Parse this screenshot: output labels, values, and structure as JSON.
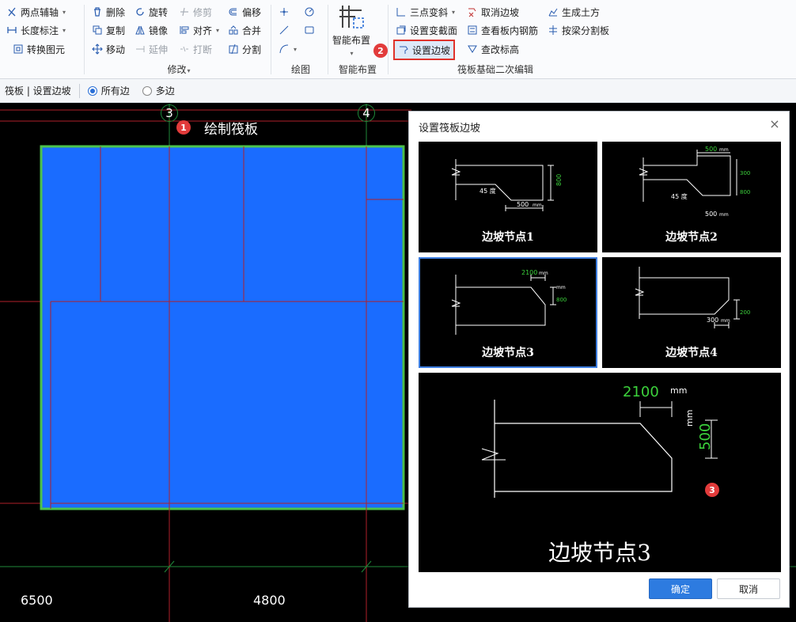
{
  "ribbon": {
    "axis": {
      "two_point_axis": "两点辅轴",
      "length_dim": "长度标注",
      "convert_element": "转换图元"
    },
    "modify": {
      "group": "修改",
      "delete": "删除",
      "rotate": "旋转",
      "trim": "修剪",
      "offset": "偏移",
      "copy": "复制",
      "mirror": "镜像",
      "align": "对齐",
      "merge": "合并",
      "move": "移动",
      "extend": "延伸",
      "break": "打断",
      "split": "分割"
    },
    "draw": {
      "group": "绘图"
    },
    "smart": {
      "button": "智能布置",
      "group": "智能布置"
    },
    "raft_edit": {
      "group": "筏板基础二次编辑",
      "three_point_slope": "三点变斜",
      "set_section": "设置变截面",
      "set_slope_edge": "设置边坡",
      "cancel_slope": "取消边坡",
      "view_rebar": "查看板内钢筋",
      "change_elevation": "查改标高",
      "gen_earthwork": "生成土方",
      "split_by_beam": "按梁分割板"
    }
  },
  "subbar": {
    "breadcrumb": "筏板 | 设置边坡",
    "option_all": "所有边",
    "option_multi": "多边"
  },
  "canvas": {
    "axis_3": "3",
    "axis_4": "4",
    "draw_raft_label": "绘制筏板",
    "dim_left": "6500",
    "dim_mid": "4800",
    "step1": "1",
    "step2": "2",
    "step3": "3"
  },
  "dialog": {
    "title": "设置筏板边坡",
    "close": "×",
    "nodes": [
      {
        "label": "边坡节点1",
        "dims": [
          "800",
          "45 度",
          "500",
          "mm"
        ]
      },
      {
        "label": "边坡节点2",
        "dims": [
          "500",
          "mm",
          "300",
          "800",
          "45 度",
          "500",
          "mm"
        ]
      },
      {
        "label": "边坡节点3",
        "dims": [
          "2100",
          "mm",
          "800",
          "mm"
        ]
      },
      {
        "label": "边坡节点4",
        "dims": [
          "200",
          "300",
          "mm"
        ]
      }
    ],
    "preview": {
      "label": "边坡节点3",
      "width_val": "2100",
      "width_unit": "mm",
      "height_val": "500",
      "height_unit": "mm"
    },
    "ok": "确定",
    "cancel": "取消"
  },
  "colors": {
    "raft_fill": "#1a6cff",
    "raft_border": "#4cc34c",
    "grid_red": "#b0202a",
    "grid_green": "#1f8a3a",
    "badge": "#e23b3b",
    "primary": "#2d7be0",
    "dim_green": "#3cd23c"
  }
}
